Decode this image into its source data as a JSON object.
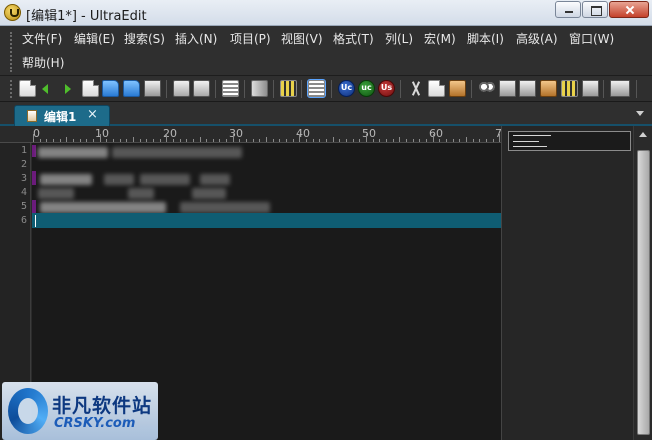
{
  "window": {
    "title": "[编辑1*] - UltraEdit"
  },
  "menu": {
    "items": [
      "文件(F)",
      "编辑(E)",
      "搜索(S)",
      "插入(N)",
      "项目(P)",
      "视图(V)",
      "格式(T)",
      "列(L)",
      "宏(M)",
      "脚本(I)",
      "高级(A)",
      "窗口(W)",
      "帮助(H)"
    ]
  },
  "toolbar": {
    "icons": [
      "new-file-icon",
      "back-arrow-icon",
      "forward-arrow-icon",
      "new-document-icon",
      "open-folder-icon",
      "open-folder-2-icon",
      "save-icon",
      "print-icon",
      "print-preview-icon",
      "properties-icon",
      "hex-edit-icon",
      "column-mode-icon",
      "list-view-icon",
      "uppercase-icon",
      "lowercase-icon",
      "capitalize-icon",
      "cut-icon",
      "copy-icon",
      "paste-icon",
      "find-icon",
      "find-in-files-icon",
      "replace-icon",
      "replace-in-files-icon",
      "macro-icon",
      "output-window-icon",
      "split-view-icon"
    ],
    "active_toggle": "list-view-icon"
  },
  "tabs": [
    {
      "label": "编辑1",
      "close": "×"
    }
  ],
  "ruler": {
    "labels": [
      "0",
      "10",
      "20",
      "30",
      "40",
      "50",
      "60",
      "7"
    ]
  },
  "editor": {
    "line_numbers": [
      "1",
      "2",
      "3",
      "4",
      "5",
      "6"
    ],
    "current_line": "6",
    "colors": {
      "background": "#1a1a1a",
      "current_line": "#0f5d73"
    }
  },
  "watermark": {
    "cn": "非凡软件站",
    "en": "CRSKY.com"
  }
}
